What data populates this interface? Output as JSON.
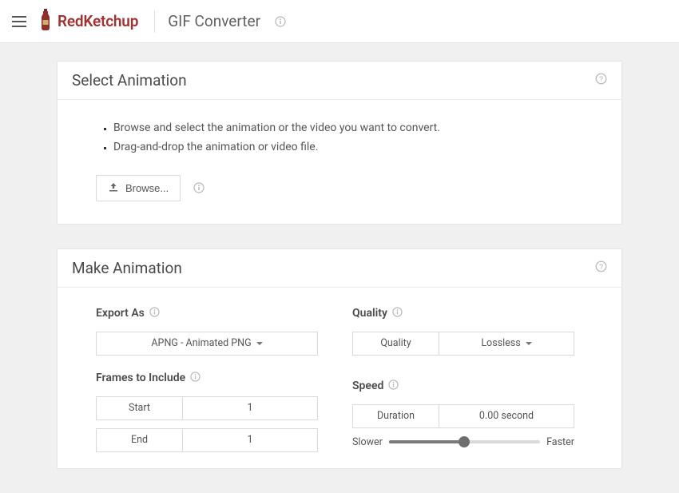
{
  "header": {
    "brand": "RedKetchup",
    "page_title": "GIF Converter"
  },
  "panels": {
    "select": {
      "title": "Select Animation",
      "instructions": [
        "Browse and select the animation or the video you want to convert.",
        "Drag-and-drop the animation or video file."
      ],
      "browse_label": "Browse..."
    },
    "make": {
      "title": "Make Animation",
      "export_as": {
        "label": "Export As",
        "value": "APNG - Animated PNG"
      },
      "frames": {
        "label": "Frames to Include",
        "start_label": "Start",
        "start_value": "1",
        "end_label": "End",
        "end_value": "1"
      },
      "quality": {
        "label": "Quality",
        "row_label": "Quality",
        "value": "Lossless"
      },
      "speed": {
        "label": "Speed",
        "duration_label": "Duration",
        "duration_value": "0.00 second",
        "slower_label": "Slower",
        "faster_label": "Faster",
        "slider_percent": 50
      }
    }
  },
  "colors": {
    "brand": "#a03232",
    "panel_border": "#e4e4e4",
    "body_bg": "#f0f0f1"
  }
}
